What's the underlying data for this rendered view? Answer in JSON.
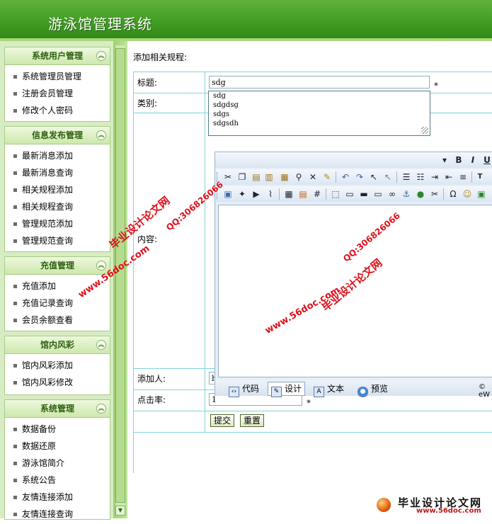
{
  "app": {
    "title": "游泳馆管理系统"
  },
  "sidebar": {
    "sections": [
      {
        "title": "系统用户管理",
        "items": [
          "系统管理员管理",
          "注册会员管理",
          "修改个人密码"
        ]
      },
      {
        "title": "信息发布管理",
        "items": [
          "最新消息添加",
          "最新消息查询",
          "相关规程添加",
          "相关规程查询",
          "管理规范添加",
          "管理规范查询"
        ]
      },
      {
        "title": "充值管理",
        "items": [
          "充值添加",
          "充值记录查询",
          "会员余额查看"
        ]
      },
      {
        "title": "馆内风彩",
        "items": [
          "馆内风彩添加",
          "馆内风彩修改"
        ]
      },
      {
        "title": "系统管理",
        "items": [
          "数据备份",
          "数据还原",
          "游泳馆简介",
          "系统公告",
          "友情连接添加",
          "友情连接查询"
        ]
      }
    ]
  },
  "main": {
    "breadcrumb": "添加相关规程:",
    "form": {
      "title_label": "标题:",
      "title_value": "sdg",
      "category_label": "类别:",
      "content_label": "内容:",
      "adder_label": "添加人:",
      "adder_value": "hsg",
      "clicks_label": "点击率:",
      "clicks_value": "1",
      "required_mark": "*",
      "submit_label": "提交",
      "reset_label": "重置"
    },
    "autocomplete": [
      "sdg",
      "sdgdsg",
      "sdgs",
      "sdgsdh"
    ],
    "editor": {
      "modes": [
        "代码",
        "设计",
        "文本",
        "预览"
      ],
      "active_mode": "设计",
      "copyright": "© eW"
    }
  },
  "watermarks": {
    "site_name": "毕业设计论文网",
    "url": "www.56doc.com",
    "qq": "QQ:306826066"
  },
  "badge": {
    "name": "毕业设计论文网",
    "url": "www.56doc.com"
  },
  "colors": {
    "header_green": "#3f9a22",
    "sidebar_bg": "#d8ecc4",
    "table_border": "#7ed6dd",
    "watermark_red": "#e0101a"
  }
}
